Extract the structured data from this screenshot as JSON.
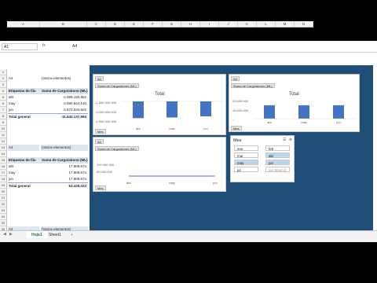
{
  "formula_bar": {
    "name_box": "A1",
    "fx": "fx",
    "value": "A4"
  },
  "columns": [
    "A",
    "B",
    "C",
    "D",
    "E",
    "F",
    "G",
    "H",
    "I",
    "J",
    "K",
    "L",
    "M",
    "N"
  ],
  "rows": [
    "1",
    "2",
    "3",
    "4",
    "5",
    "6",
    "7",
    "8",
    "9",
    "10",
    "11",
    "12",
    "13",
    "14",
    "15",
    "16",
    "17",
    "18",
    "19",
    "20",
    "21",
    "22",
    "23",
    "24",
    "25",
    "26",
    "27",
    "28"
  ],
  "pivot1": {
    "filter_label": "A4",
    "filter_value": "(Varios elementos)",
    "row_header": "Etiquetas de fila",
    "value_header": "Suma de Cargo/abono (ML)",
    "rows": [
      {
        "label": "abr",
        "value": "-2.989.150,952"
      },
      {
        "label": "may",
        "value": "-2.880.944,140"
      },
      {
        "label": "jun",
        "value": "-2.672.534,602"
      }
    ],
    "total_label": "Total general",
    "total_value": "-11.542.137,994"
  },
  "pivot2": {
    "filter_label": "A4",
    "filter_value": "(Varios elementos)",
    "row_header": "Etiquetas de fila",
    "value_header": "Suma de Cargo/abono (ML)",
    "rows": [
      {
        "label": "abr",
        "value": "17.809,674"
      },
      {
        "label": "may",
        "value": "17.809,674"
      },
      {
        "label": "jun",
        "value": "17.809,674"
      }
    ],
    "total_label": "Total general",
    "total_value": "53.429,023"
  },
  "pivot3": {
    "filter_label": "A4",
    "filter_value": "(Varios elementos)"
  },
  "chart1": {
    "filter_chip": "A4",
    "series_chip": "Suma de Cargo/abono (ML)",
    "title": "Total",
    "axis_field_chip": "Mes",
    "y_ticks": [
      "-1.500.000.000",
      "-3.000.000.000",
      "-4.500.000.000"
    ],
    "categories": [
      "abr",
      "may",
      "jun"
    ]
  },
  "chart2": {
    "filter_chip": "A4",
    "series_chip": "Suma de Cargo/abono (ML)",
    "title": "Total",
    "axis_field_chip": "Mes",
    "y_ticks": [
      "20.000.000",
      "10.000.000",
      "-"
    ],
    "categories": [
      "abr",
      "may",
      "jun"
    ]
  },
  "chart3": {
    "filter_chip": "A4",
    "series_chip": "Suma de Cargo/abono (ML)",
    "axis_field_chip": "Mes",
    "y_ticks": [
      "100.000.000",
      "50.000.000"
    ],
    "categories": [
      "abr",
      "may",
      "jun"
    ]
  },
  "chart_data": [
    {
      "type": "bar",
      "title": "Total",
      "categories": [
        "abr",
        "may",
        "jun"
      ],
      "values": [
        -2989150.952,
        -2880944.14,
        -2672534.602
      ]
    },
    {
      "type": "bar",
      "title": "Total",
      "categories": [
        "abr",
        "may",
        "jun"
      ],
      "values": [
        17809.674,
        17809.674,
        17809.674
      ]
    },
    {
      "type": "line",
      "categories": [
        "abr",
        "may",
        "jun"
      ],
      "values": [
        17809.674,
        17809.674,
        17809.674
      ]
    }
  ],
  "slicer": {
    "title": "Mes",
    "items": [
      "ene",
      "feb",
      "mar",
      "abr",
      "may",
      "jun",
      "jul",
      "(en blanco)"
    ],
    "selected": [
      "abr",
      "may",
      "jun"
    ]
  },
  "sheet_tabs": [
    "Hoja1",
    "Sheet1"
  ],
  "add_sheet": "+",
  "colors": {
    "dashboard_bg": "#1f4e79",
    "bar": "#4472c4",
    "selected_tab": "#217346"
  }
}
